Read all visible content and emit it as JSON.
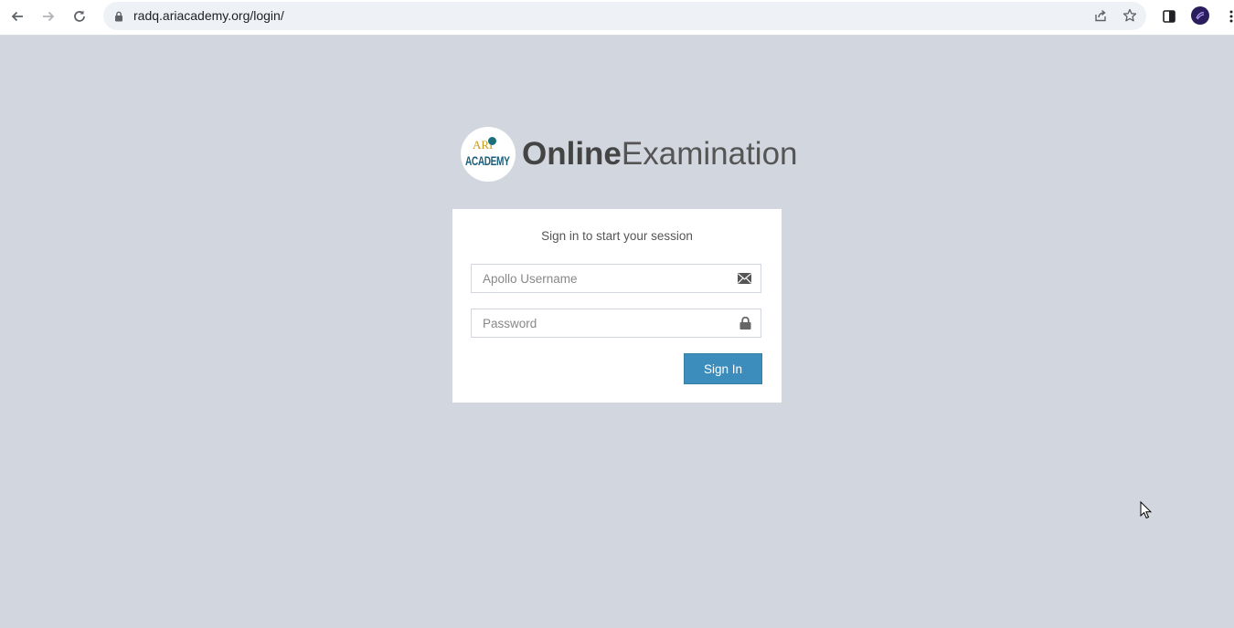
{
  "browser": {
    "url": "radq.ariacademy.org/login/",
    "icons": [
      "back-arrow-icon",
      "forward-arrow-icon",
      "reload-icon",
      "lock-icon",
      "share-icon",
      "star-icon",
      "side-panel-icon",
      "profile-avatar",
      "more-vert-icon"
    ]
  },
  "logo": {
    "top_text": "ARI",
    "bottom_text": "ACADEMY"
  },
  "title": {
    "bold": "Online",
    "light": "Examination"
  },
  "login": {
    "message": "Sign in to start your session",
    "username_placeholder": "Apollo Username",
    "password_placeholder": "Password",
    "signin_label": "Sign In"
  },
  "colors": {
    "background": "#d2d6de",
    "primary_button": "#3c8dbc"
  }
}
